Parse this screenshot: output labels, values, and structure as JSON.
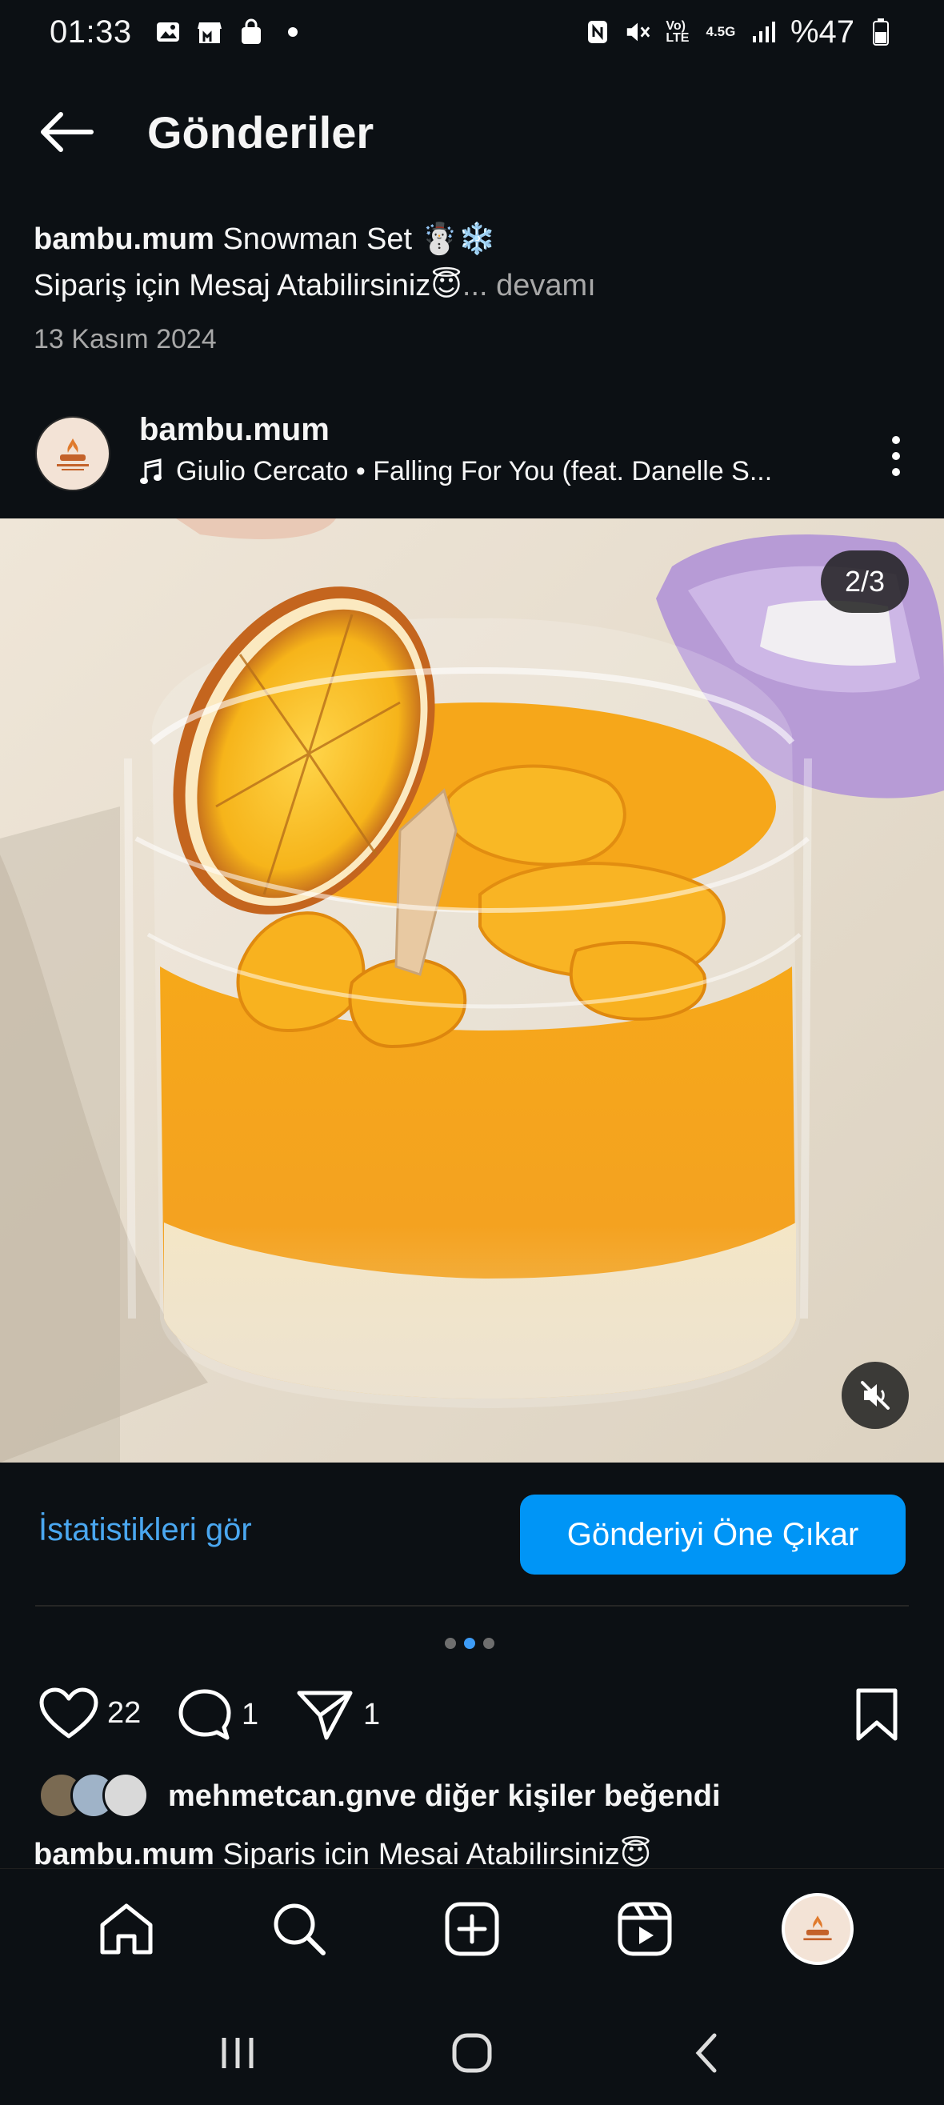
{
  "status_bar": {
    "time": "01:33",
    "battery": "%47",
    "network": "4.5G"
  },
  "header": {
    "title": "Gönderiler"
  },
  "previous_post": {
    "username": "bambu.mum",
    "caption_line1": " Snowman Set ☃️❄️",
    "caption_line2": "Sipariş için Mesaj Atabilirsiniz😇",
    "more": "... devamı",
    "date": "13 Kasım 2024"
  },
  "post": {
    "username": "bambu.mum",
    "music": "Giulio Cercato • Falling For You (feat. Danelle S...",
    "media_counter": "2/3",
    "stats_link": "İstatistikleri gör",
    "boost_button": "Gönderiyi Öne Çıkar",
    "likes_count": "22",
    "comments_count": "1",
    "shares_count": "1",
    "liked_by_user": "mehmetcan.gn",
    "liked_by_suffix": " ve diğer kişiler beğendi",
    "caption_user": "bambu.mum",
    "caption_text": " Siparis icin Mesai Atabilirsiniz😇"
  },
  "colors": {
    "background": "#0c1014",
    "accent_blue": "#0095f6",
    "link_blue": "#4aa7f0",
    "muted": "#a8a8a8"
  },
  "icons": [
    "back-arrow-icon",
    "more-vertical-icon",
    "music-note-icon",
    "mute-icon",
    "heart-icon",
    "comment-icon",
    "share-icon",
    "bookmark-icon",
    "home-icon",
    "search-icon",
    "create-icon",
    "reels-icon",
    "profile-avatar"
  ]
}
